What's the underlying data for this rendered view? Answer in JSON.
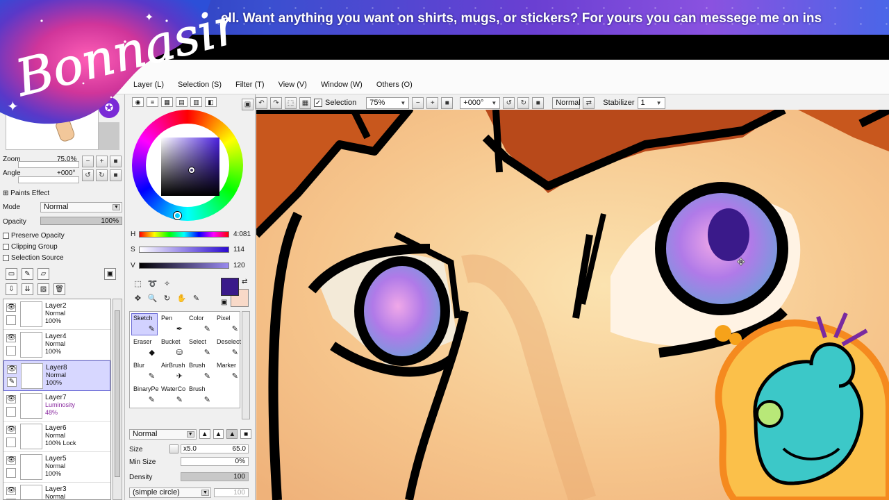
{
  "stream": {
    "ticker_text": "ell. Want anything you want on shirts, mugs, or stickers? For yours you can messege me on ins",
    "logo_text": "Bonnasin"
  },
  "menu": {
    "items": [
      "Layer (L)",
      "Selection (S)",
      "Filter (T)",
      "View (V)",
      "Window (W)",
      "Others (O)"
    ]
  },
  "toolbar": {
    "selection_label": "Selection",
    "zoom_value": "75%",
    "rotate_value": "+000°",
    "blend_mode": "Normal",
    "stabilizer_label": "Stabilizer",
    "stabilizer_value": "1"
  },
  "navigator": {
    "zoom_label": "Zoom",
    "zoom_value": "75.0%",
    "angle_label": "Angle",
    "angle_value": "+000°"
  },
  "paints_effect": {
    "header": "Paints Effect",
    "mode_label": "Mode",
    "mode_value": "Normal",
    "opacity_label": "Opacity",
    "opacity_value": "100%",
    "preserve_opacity": "Preserve Opacity",
    "clipping_group": "Clipping Group",
    "selection_source": "Selection Source"
  },
  "layers": [
    {
      "name": "Layer2",
      "mode": "Normal",
      "opacity": "100%",
      "selected": false
    },
    {
      "name": "Layer4",
      "mode": "Normal",
      "opacity": "100%",
      "selected": false
    },
    {
      "name": "Layer8",
      "mode": "Normal",
      "opacity": "100%",
      "selected": true
    },
    {
      "name": "Layer7",
      "mode": "Luminosity",
      "opacity": "48%",
      "selected": false
    },
    {
      "name": "Layer6",
      "mode": "Normal",
      "opacity": "100% Lock",
      "selected": false
    },
    {
      "name": "Layer5",
      "mode": "Normal",
      "opacity": "100%",
      "selected": false
    },
    {
      "name": "Layer3",
      "mode": "Normal",
      "opacity": "",
      "selected": false
    }
  ],
  "color": {
    "h_label": "H",
    "h_value": "4:081",
    "s_label": "S",
    "s_value": "114",
    "v_label": "V",
    "v_value": "120",
    "main_color": "#3a1a8a",
    "sub_color": "#f8d9c8"
  },
  "tools": [
    {
      "name": "Sketch",
      "icon": "✎",
      "selected": true
    },
    {
      "name": "Pen",
      "icon": "✒",
      "selected": false
    },
    {
      "name": "Color",
      "icon": "✎",
      "selected": false
    },
    {
      "name": "Pixel",
      "icon": "✎",
      "selected": false
    },
    {
      "name": "Eraser",
      "icon": "◆",
      "selected": false
    },
    {
      "name": "Bucket",
      "icon": "⛁",
      "selected": false
    },
    {
      "name": "Select",
      "icon": "✎",
      "selected": false
    },
    {
      "name": "Deselect",
      "icon": "✎",
      "selected": false
    },
    {
      "name": "Blur",
      "icon": "✎",
      "selected": false
    },
    {
      "name": "AirBrush",
      "icon": "✈",
      "selected": false
    },
    {
      "name": "Brush",
      "icon": "✎",
      "selected": false
    },
    {
      "name": "Marker",
      "icon": "✎",
      "selected": false
    },
    {
      "name": "BinaryPe",
      "icon": "✎",
      "selected": false
    },
    {
      "name": "WaterCo",
      "icon": "✎",
      "selected": false
    },
    {
      "name": "Brush",
      "icon": "✎",
      "selected": false
    },
    {
      "name": "",
      "icon": "",
      "selected": false
    }
  ],
  "brush": {
    "mode": "Normal",
    "size_label": "Size",
    "size_mult": "x5.0",
    "size_value": "65.0",
    "min_size_label": "Min Size",
    "min_size_value": "0%",
    "density_label": "Density",
    "density_value": "100",
    "shape": "(simple circle)",
    "shape_value": "100"
  }
}
